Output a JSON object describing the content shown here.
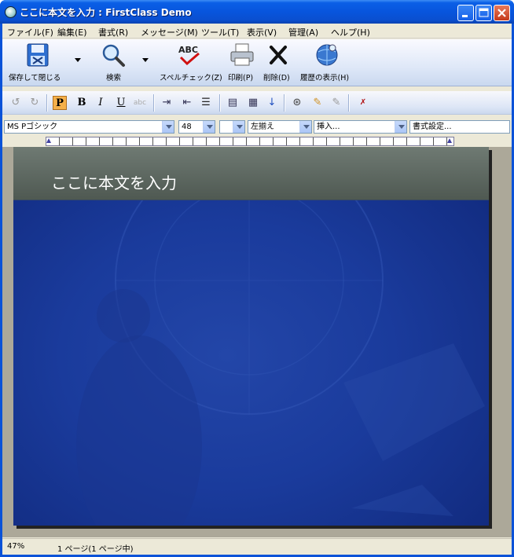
{
  "window": {
    "title": "ここに本文を入力 : FirstClass Demo"
  },
  "menu": [
    "ファイル(F)",
    "編集(E)",
    "書式(R)",
    "メッセージ(M)",
    "ツール(T)",
    "表示(V)",
    "管理(A)",
    "ヘルプ(H)"
  ],
  "toolbar": {
    "save_close": "保存して閉じる",
    "search": "検索",
    "spell_check": "スペルチェック(Z)",
    "print": "印刷(P)",
    "delete": "削除(D)",
    "history": "履歴の表示(H)"
  },
  "format_toolbar": {
    "paragraph": "P",
    "bold": "B",
    "italic": "I",
    "underline": "U"
  },
  "format_bar": {
    "font": "MS Pゴシック",
    "size": "48",
    "style": "",
    "align": "左揃え",
    "insert": "挿入...",
    "format_settings": "書式設定..."
  },
  "slide": {
    "title": "ここに本文を入力"
  },
  "status": {
    "zoom": "47%",
    "pages": "1 ページ(1 ページ中)"
  },
  "colors": {
    "slide_bg": "#1a3b9c",
    "title_band": "#5b655f",
    "title_bar": "#0855dd"
  }
}
